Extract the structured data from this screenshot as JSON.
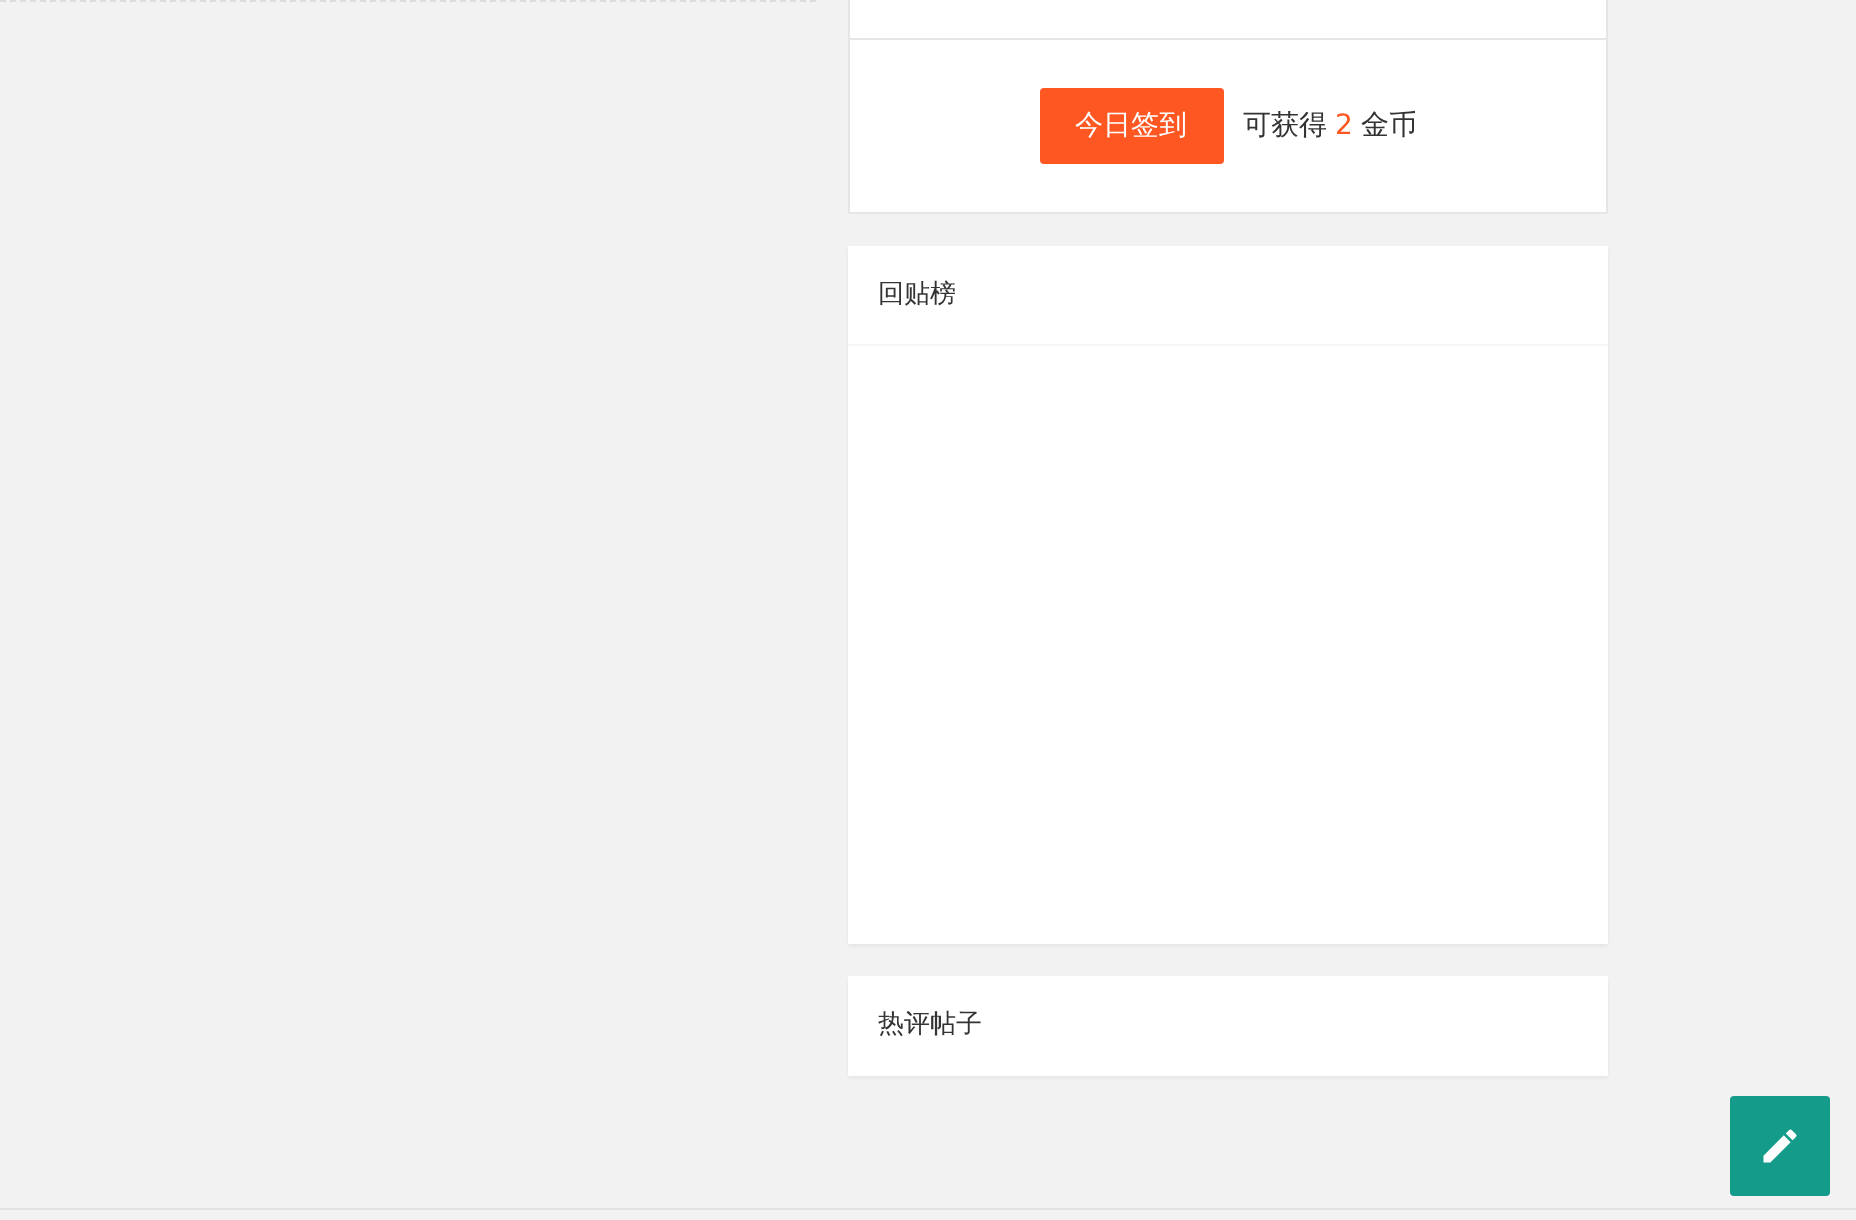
{
  "checkin": {
    "button": "今日签到",
    "reward_prefix": "可获得",
    "reward_amount": "2",
    "reward_suffix": "金币"
  },
  "panels": [
    {
      "title": "回贴榜",
      "kind": "tall"
    },
    {
      "title": "热评帖子",
      "kind": "header"
    }
  ]
}
